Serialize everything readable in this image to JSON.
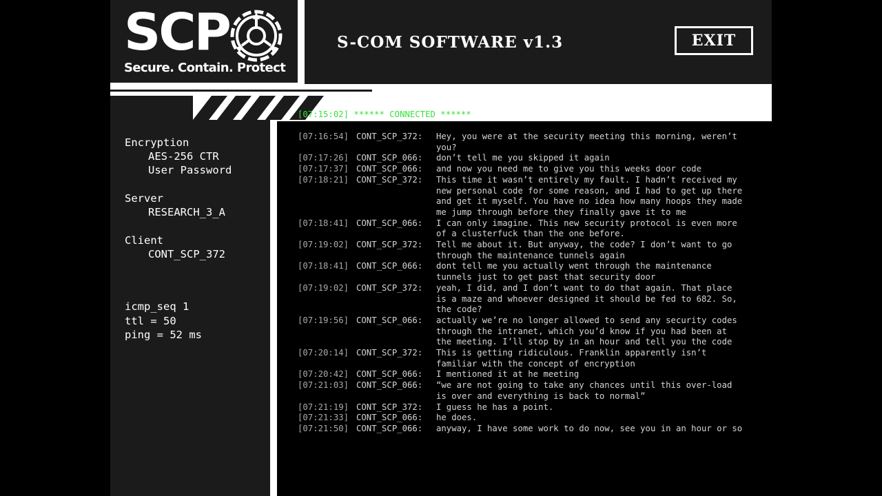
{
  "logo": {
    "text": "SCP",
    "tagline": "Secure. Contain. Protect"
  },
  "header": {
    "title": "S-COM SOFTWARE v1.3",
    "exit_label": "EXIT"
  },
  "sidebar": {
    "encryption_label": "Encryption",
    "encryption_value_1": "AES-256 CTR",
    "encryption_value_2": "User Password",
    "server_label": "Server",
    "server_value": "RESEARCH_3_A",
    "client_label": "Client",
    "client_value": "CONT_SCP_372",
    "icmp_seq": "icmp_seq 1",
    "ttl": "ttl = 50",
    "ping": "ping = 52 ms"
  },
  "chat": {
    "connected": "[07:15:02] ****** CONNECTED ******",
    "messages": [
      {
        "time": "[07:16:54]",
        "sender": "CONT_SCP_372:",
        "text": "Hey, you were at the security meeting this morning, weren’t you?"
      },
      {
        "time": "[07:17:26]",
        "sender": "CONT_SCP_066:",
        "text": "don’t tell me you skipped it again"
      },
      {
        "time": "[07:17:37]",
        "sender": "CONT_SCP_066:",
        "text": "and now you need me to give you this weeks door code"
      },
      {
        "time": "[07:18:21]",
        "sender": "CONT_SCP_372:",
        "text": "This time it wasn’t entirely my fault. I hadn’t received my new personal code for some reason, and I had to get up there and get it myself. You have no idea how many hoops they made me jump through before they finally gave it to me"
      },
      {
        "time": "[07:18:41]",
        "sender": "CONT_SCP_066:",
        "text": "I can only imagine. This new security protocol is even more of a clusterfuck than the one before."
      },
      {
        "time": "[07:19:02]",
        "sender": "CONT_SCP_372:",
        "text": "Tell me about it. But anyway, the code? I don’t want to go through the maintenance tunnels again"
      },
      {
        "time": "[07:18:41]",
        "sender": "CONT_SCP_066:",
        "text": "dont tell me you actually went through the maintenance tunnels just to get past that security door"
      },
      {
        "time": "[07:19:02]",
        "sender": "CONT_SCP_372:",
        "text": "yeah, I did, and I don’t want to do that again. That place is a maze and whoever designed it should be fed to 682. So, the code?"
      },
      {
        "time": "[07:19:56]",
        "sender": "CONT_SCP_066:",
        "text": "actually we’re no longer allowed to send any security codes through the intranet, which you’d know if you had been at the meeting. I’ll stop by in an hour and tell you the code"
      },
      {
        "time": "[07:20:14]",
        "sender": "CONT_SCP_372:",
        "text": "This is getting ridiculous. Franklin apparently isn’t familiar with the concept of encryption"
      },
      {
        "time": "[07:20:42]",
        "sender": "CONT_SCP_066:",
        "text": "I mentioned it at he meeting"
      },
      {
        "time": "[07:21:03]",
        "sender": "CONT_SCP_066:",
        "text": "“we are not going to take any chances until this over-load is over and everything is back to normal”"
      },
      {
        "time": "[07:21:19]",
        "sender": "CONT_SCP_372:",
        "text": "I guess he has a point."
      },
      {
        "time": "[07:21:33]",
        "sender": "CONT_SCP_066:",
        "text": "he does."
      },
      {
        "time": "[07:21:50]",
        "sender": "CONT_SCP_066:",
        "text": "anyway, I have some work to do now, see you in an hour or so"
      }
    ]
  },
  "colors": {
    "panel": "#1b1b1b",
    "connected": "#3be03b",
    "chat_text": "#d4d4d4",
    "timestamp": "#a9a9a9"
  }
}
